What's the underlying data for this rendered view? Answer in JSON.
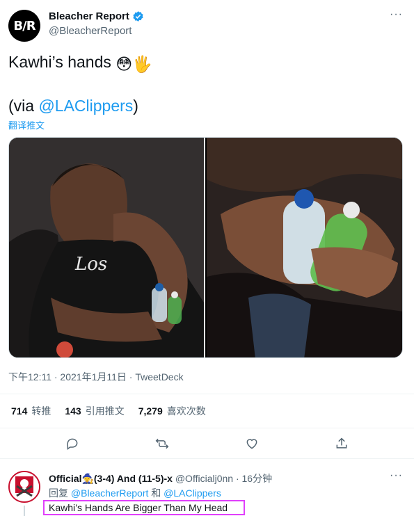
{
  "tweet": {
    "avatar_text": "B/R",
    "display_name": "Bleacher Report",
    "handle": "@BleacherReport",
    "more_label": "···",
    "line1": "Kawhi’s hands",
    "line1_emojis": "😳🖐",
    "via_prefix": "(via ",
    "via_mention": "@LAClippers",
    "via_suffix": ")",
    "translate_label": "翻译推文",
    "meta": "下午12:11 · 2021年1月11日 · TweetDeck",
    "stats": [
      {
        "count": "714",
        "label": "转推"
      },
      {
        "count": "143",
        "label": "引用推文"
      },
      {
        "count": "7,279",
        "label": "喜欢次数"
      }
    ],
    "actions": [
      "reply-icon",
      "retweet-icon",
      "like-icon",
      "share-icon"
    ]
  },
  "reply": {
    "name": "Official🧙(3-4) And (11-5)-x",
    "handle": "@Officialj0nn · 16分钟",
    "more_label": "···",
    "reply_prefix": "回复 ",
    "reply_mention1": "@BleacherReport",
    "reply_and": " 和 ",
    "reply_mention2": "@LAClippers",
    "text": "Kawhi’s Hands Are Bigger Than My Head"
  },
  "colors": {
    "accent": "#1d9bf0",
    "muted": "#536471",
    "highlight": "#e040fb"
  }
}
